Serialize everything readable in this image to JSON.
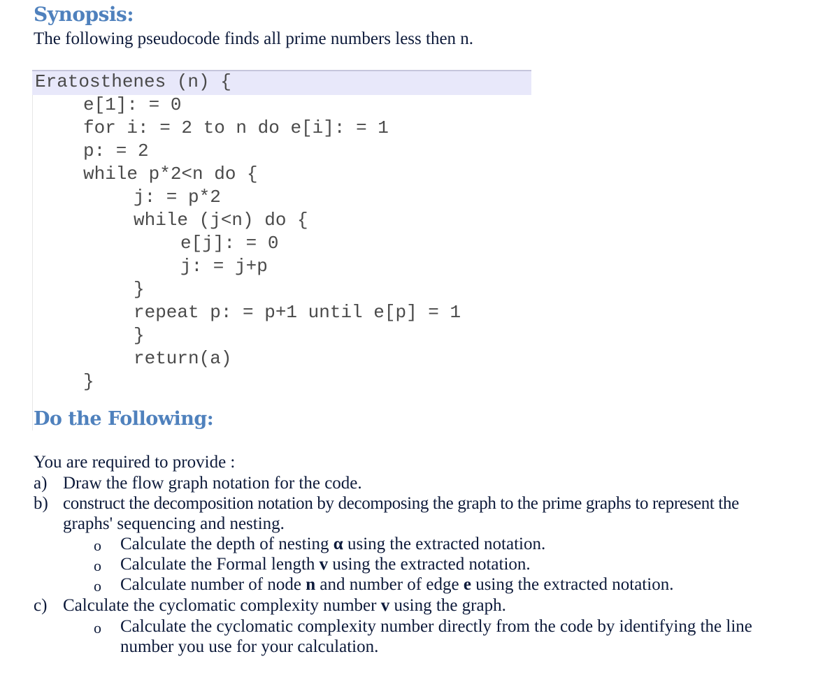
{
  "synopsis": {
    "title": "Synopsis:",
    "text": "The following pseudocode finds all prime numbers less then n."
  },
  "code": {
    "lines": [
      "Eratosthenes (n) {",
      "e[1]: = 0",
      "for i: = 2 to n do e[i]: = 1",
      "p: = 2",
      "while p*2<n do {",
      "j: = p*2",
      "while (j<n) do {",
      "e[j]: = 0",
      "j: = j+p",
      "}",
      "repeat p: = p+1 until e[p] = 1",
      "}",
      "return(a)",
      "}"
    ]
  },
  "tasks": {
    "title": "Do the Following:",
    "intro": "You are required to provide :",
    "a": {
      "marker": "a)",
      "text": "Draw the flow graph notation for the code."
    },
    "b": {
      "marker": "b)",
      "text_line1": "construct the decomposition notation by decomposing the graph to the prime graphs to represent the",
      "text_line2": "graphs' sequencing and nesting.",
      "bullets": [
        {
          "marker": "o",
          "pre": "Calculate the depth of nesting ",
          "bold": "α",
          "post": " using the extracted notation."
        },
        {
          "marker": "o",
          "pre": "Calculate the Formal length ",
          "bold": "v",
          "post": " using the extracted notation."
        },
        {
          "marker": "o",
          "pre": "Calculate number of node ",
          "bold": "n",
          "mid": " and number of edge ",
          "bold2": "e",
          "post": " using the extracted notation."
        }
      ]
    },
    "c": {
      "marker": "c)",
      "pre": "Calculate the cyclomatic complexity number ",
      "bold": "v",
      "post": " using the graph.",
      "bullets": [
        {
          "marker": "o",
          "line1": "Calculate the cyclomatic complexity number directly from the code by identifying the line",
          "line2": "number you use for your calculation."
        }
      ]
    }
  }
}
